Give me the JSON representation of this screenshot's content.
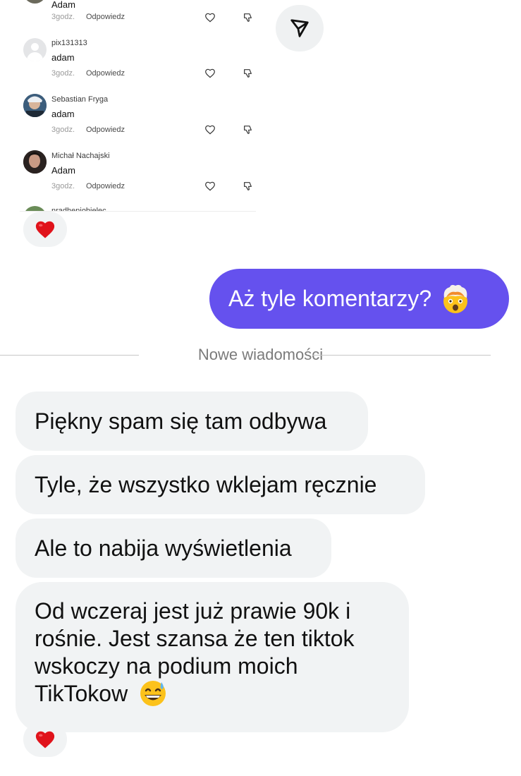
{
  "comments": [
    {
      "name": "Adam",
      "text": "",
      "time": "3godz.",
      "reply": "Odpowiedz"
    },
    {
      "name": "pix131313",
      "text": "adam",
      "time": "3godz.",
      "reply": "Odpowiedz"
    },
    {
      "name": "Sebastian Fryga",
      "text": "adam",
      "time": "3godz.",
      "reply": "Odpowiedz"
    },
    {
      "name": "Michał Nachajski",
      "text": "Adam",
      "time": "3godz.",
      "reply": "Odpowiedz"
    },
    {
      "name": "nradheniobielec",
      "text": "",
      "time": "",
      "reply": ""
    }
  ],
  "icons": {
    "like": "heart-outline-icon",
    "dislike": "thumbs-down-icon",
    "send": "send-paper-plane-icon",
    "reaction": "red-heart-emoji",
    "outgoing_emoji": "exploding-head-emoji",
    "incoming_emoji": "grinning-sweat-emoji"
  },
  "outgoing": {
    "text": "Aż tyle komentarzy?"
  },
  "divider": {
    "label": "Nowe wiadomości"
  },
  "incoming": [
    {
      "text": "Piękny spam się tam odbywa"
    },
    {
      "text": "Tyle, że wszystko wklejam ręcznie"
    },
    {
      "text": "Ale to nabija wyświetlenia"
    },
    {
      "text": "Od wczeraj jest już prawie 90k i rośnie. Jest szansa że ten tiktok wskoczy na podium moich TikTokow"
    }
  ],
  "colors": {
    "outgoing_bubble": "#6551ee",
    "incoming_bubble": "#f1f3f4",
    "heart": "#e0131b"
  }
}
